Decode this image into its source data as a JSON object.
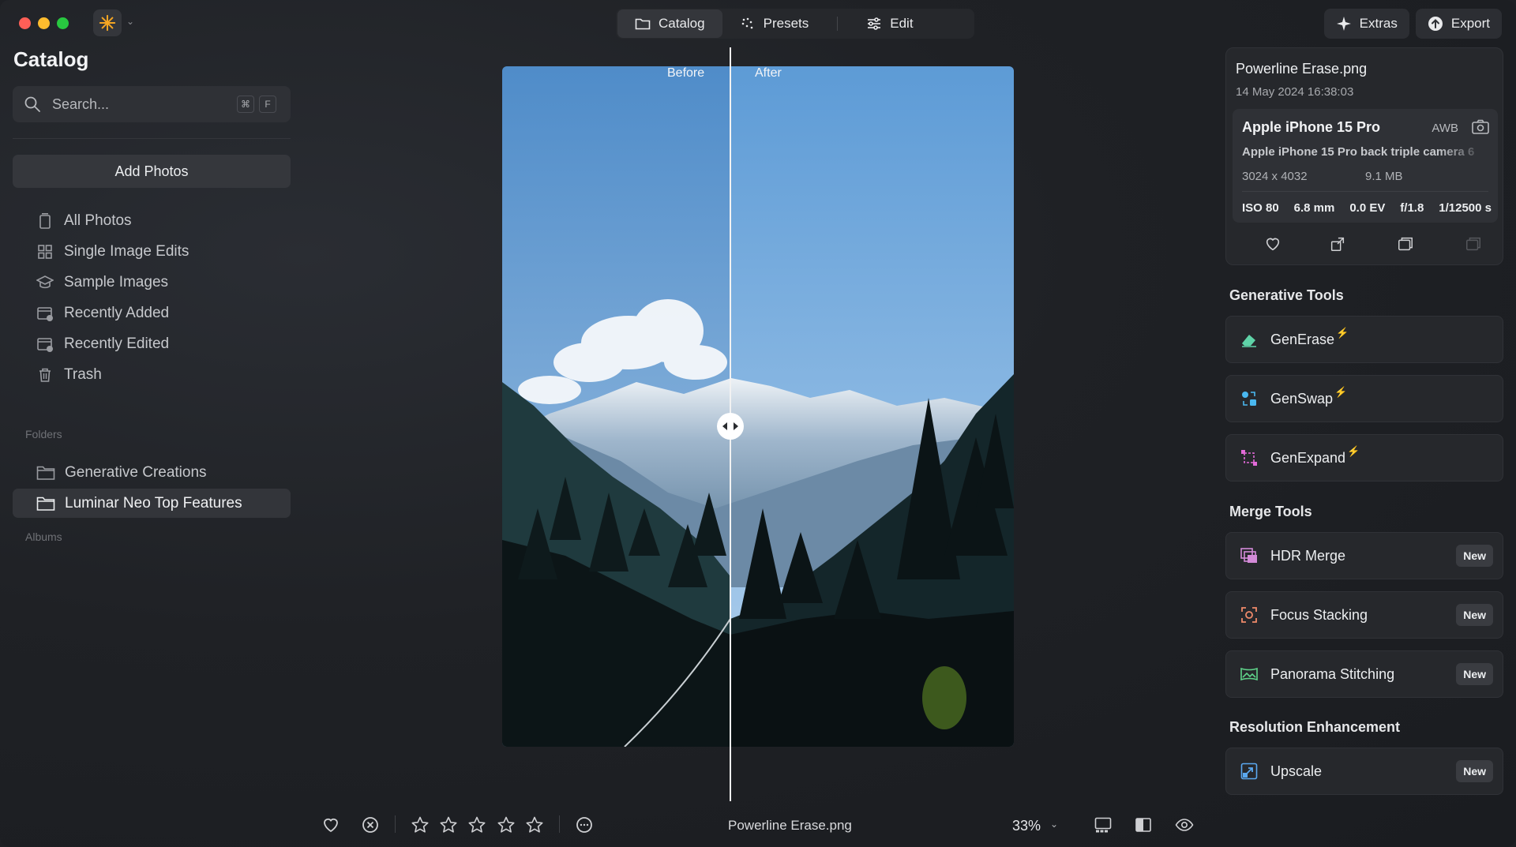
{
  "window": {
    "app_logo_icon": "sun-asterisk-icon",
    "traffic_colors": {
      "close": "#ff5f57",
      "minimize": "#febc2e",
      "zoom": "#28c840"
    }
  },
  "topnav": {
    "catalog_label": "Catalog",
    "presets_label": "Presets",
    "edit_label": "Edit"
  },
  "topright": {
    "extras_label": "Extras",
    "export_label": "Export"
  },
  "sidebar": {
    "title": "Catalog",
    "search_placeholder": "Search...",
    "search_kbd_cmd": "⌘",
    "search_kbd_key": "F",
    "add_photos_label": "Add Photos",
    "items": [
      {
        "label": "All Photos",
        "icon": "phone-stack-icon"
      },
      {
        "label": "Single Image Edits",
        "icon": "grid-icon"
      },
      {
        "label": "Sample Images",
        "icon": "graduation-cap-icon"
      },
      {
        "label": "Recently Added",
        "icon": "calendar-plus-icon"
      },
      {
        "label": "Recently Edited",
        "icon": "calendar-edit-icon"
      },
      {
        "label": "Trash",
        "icon": "trash-icon"
      }
    ],
    "folders_label": "Folders",
    "folders": [
      {
        "label": "Generative Creations",
        "selected": false
      },
      {
        "label": "Luminar Neo Top Features",
        "selected": true
      }
    ],
    "albums_label": "Albums"
  },
  "viewer": {
    "before_label": "Before",
    "after_label": "After",
    "split_handle_icon": "split-arrows-icon"
  },
  "bottombar": {
    "filename": "Powerline Erase.png",
    "zoom": "33%",
    "rating_stars": 0
  },
  "info": {
    "filename": "Powerline Erase.png",
    "date": "14 May 2024 16:38:03",
    "camera": "Apple iPhone 15 Pro",
    "white_balance": "AWB",
    "lens": "Apple iPhone 15 Pro back triple camera 6",
    "resolution": "3024 x 4032",
    "file_size": "9.1 MB",
    "iso": "ISO 80",
    "focal": "6.8 mm",
    "ev": "0.0 EV",
    "aperture": "f/1.8",
    "shutter": "1/12500 s"
  },
  "generative": {
    "heading": "Generative Tools",
    "tools": [
      {
        "label": "GenErase",
        "icon": "eraser-icon",
        "color": "#5fd3a8"
      },
      {
        "label": "GenSwap",
        "icon": "swap-icon",
        "color": "#4ab8f0"
      },
      {
        "label": "GenExpand",
        "icon": "expand-icon",
        "color": "#e26ad8"
      }
    ]
  },
  "merge": {
    "heading": "Merge Tools",
    "tools": [
      {
        "label": "HDR Merge",
        "badge": "New",
        "icon": "hdr-icon"
      },
      {
        "label": "Focus Stacking",
        "badge": "New",
        "icon": "focus-icon"
      },
      {
        "label": "Panorama Stitching",
        "badge": "New",
        "icon": "panorama-icon"
      }
    ]
  },
  "resolution": {
    "heading": "Resolution Enhancement",
    "tools": [
      {
        "label": "Upscale",
        "badge": "New",
        "icon": "upscale-icon"
      }
    ]
  }
}
